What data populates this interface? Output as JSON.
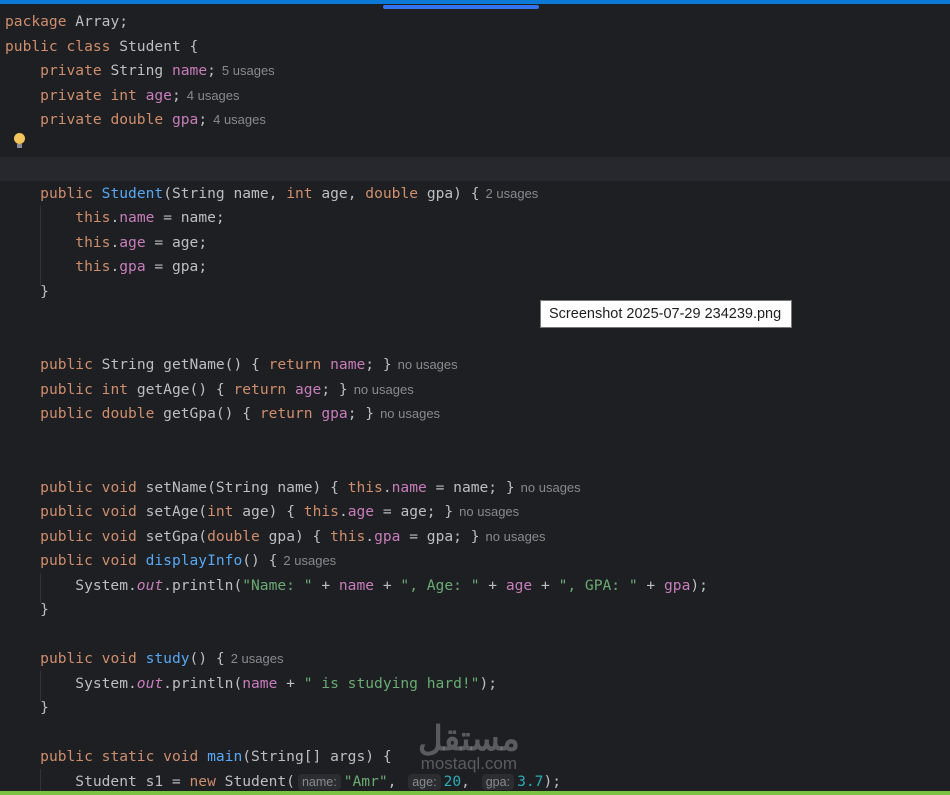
{
  "tooltip": "Screenshot 2025-07-29 234239.png",
  "watermark": {
    "arabic": "مستقل",
    "latin": "mostaql.com"
  },
  "colors": {
    "background": "#1e1f22",
    "keyword": "#cf8e6d",
    "field": "#c77dbb",
    "method": "#56a8f5",
    "string": "#6aab73",
    "number": "#2aacb8",
    "text": "#bcbec4",
    "hint": "#868a91"
  },
  "lines": [
    [
      [
        "k",
        "package "
      ],
      [
        "t",
        "Array;"
      ]
    ],
    [
      [
        "k",
        "public class "
      ],
      [
        "t",
        "Student {"
      ]
    ],
    [
      [
        "t",
        "    "
      ],
      [
        "k",
        "private "
      ],
      [
        "t",
        "String "
      ],
      [
        "f",
        "name"
      ],
      [
        "t",
        ";"
      ],
      [
        "u",
        "5 usages"
      ]
    ],
    [
      [
        "t",
        "    "
      ],
      [
        "k",
        "private int "
      ],
      [
        "f",
        "age"
      ],
      [
        "t",
        ";"
      ],
      [
        "u",
        "4 usages"
      ]
    ],
    [
      [
        "t",
        "    "
      ],
      [
        "k",
        "private double "
      ],
      [
        "f",
        "gpa"
      ],
      [
        "t",
        ";"
      ],
      [
        "u",
        "4 usages"
      ]
    ],
    [],
    [],
    [
      [
        "t",
        "    "
      ],
      [
        "k",
        "public "
      ],
      [
        "m",
        "Student"
      ],
      [
        "t",
        "(String name, "
      ],
      [
        "k",
        "int "
      ],
      [
        "t",
        "age, "
      ],
      [
        "k",
        "double "
      ],
      [
        "t",
        "gpa) {"
      ],
      [
        "u",
        "2 usages"
      ]
    ],
    [
      [
        "t",
        "        "
      ],
      [
        "k",
        "this"
      ],
      [
        "t",
        "."
      ],
      [
        "f",
        "name"
      ],
      [
        "t",
        " = name;"
      ]
    ],
    [
      [
        "t",
        "        "
      ],
      [
        "k",
        "this"
      ],
      [
        "t",
        "."
      ],
      [
        "f",
        "age"
      ],
      [
        "t",
        " = age;"
      ]
    ],
    [
      [
        "t",
        "        "
      ],
      [
        "k",
        "this"
      ],
      [
        "t",
        "."
      ],
      [
        "f",
        "gpa"
      ],
      [
        "t",
        " = gpa;"
      ]
    ],
    [
      [
        "t",
        "    }"
      ]
    ],
    [],
    [],
    [
      [
        "t",
        "    "
      ],
      [
        "k",
        "public "
      ],
      [
        "t",
        "String getName() { "
      ],
      [
        "k",
        "return "
      ],
      [
        "f",
        "name"
      ],
      [
        "t",
        "; }"
      ],
      [
        "u",
        "no usages"
      ]
    ],
    [
      [
        "t",
        "    "
      ],
      [
        "k",
        "public int "
      ],
      [
        "t",
        "getAge() { "
      ],
      [
        "k",
        "return "
      ],
      [
        "f",
        "age"
      ],
      [
        "t",
        "; }"
      ],
      [
        "u",
        "no usages"
      ]
    ],
    [
      [
        "t",
        "    "
      ],
      [
        "k",
        "public double "
      ],
      [
        "t",
        "getGpa() { "
      ],
      [
        "k",
        "return "
      ],
      [
        "f",
        "gpa"
      ],
      [
        "t",
        "; }"
      ],
      [
        "u",
        "no usages"
      ]
    ],
    [],
    [],
    [
      [
        "t",
        "    "
      ],
      [
        "k",
        "public void "
      ],
      [
        "t",
        "setName(String name) { "
      ],
      [
        "k",
        "this"
      ],
      [
        "t",
        "."
      ],
      [
        "f",
        "name"
      ],
      [
        "t",
        " = name; }"
      ],
      [
        "u",
        "no usages"
      ]
    ],
    [
      [
        "t",
        "    "
      ],
      [
        "k",
        "public void "
      ],
      [
        "t",
        "setAge("
      ],
      [
        "k",
        "int "
      ],
      [
        "t",
        "age) { "
      ],
      [
        "k",
        "this"
      ],
      [
        "t",
        "."
      ],
      [
        "f",
        "age"
      ],
      [
        "t",
        " = age; }"
      ],
      [
        "u",
        "no usages"
      ]
    ],
    [
      [
        "t",
        "    "
      ],
      [
        "k",
        "public void "
      ],
      [
        "t",
        "setGpa("
      ],
      [
        "k",
        "double "
      ],
      [
        "t",
        "gpa) { "
      ],
      [
        "k",
        "this"
      ],
      [
        "t",
        "."
      ],
      [
        "f",
        "gpa"
      ],
      [
        "t",
        " = gpa; }"
      ],
      [
        "u",
        "no usages"
      ]
    ],
    [
      [
        "t",
        "    "
      ],
      [
        "k",
        "public void "
      ],
      [
        "m",
        "displayInfo"
      ],
      [
        "t",
        "() {"
      ],
      [
        "u",
        "2 usages"
      ]
    ],
    [
      [
        "t",
        "        System."
      ],
      [
        "o",
        "out"
      ],
      [
        "t",
        ".println("
      ],
      [
        "s",
        "\"Name: \""
      ],
      [
        "t",
        " + "
      ],
      [
        "f",
        "name"
      ],
      [
        "t",
        " + "
      ],
      [
        "s",
        "\", Age: \""
      ],
      [
        "t",
        " + "
      ],
      [
        "f",
        "age"
      ],
      [
        "t",
        " + "
      ],
      [
        "s",
        "\", GPA: \""
      ],
      [
        "t",
        " + "
      ],
      [
        "f",
        "gpa"
      ],
      [
        "t",
        ");"
      ]
    ],
    [
      [
        "t",
        "    }"
      ]
    ],
    [],
    [
      [
        "t",
        "    "
      ],
      [
        "k",
        "public void "
      ],
      [
        "m",
        "study"
      ],
      [
        "t",
        "() {"
      ],
      [
        "u",
        "2 usages"
      ]
    ],
    [
      [
        "t",
        "        System."
      ],
      [
        "o",
        "out"
      ],
      [
        "t",
        ".println("
      ],
      [
        "f",
        "name"
      ],
      [
        "t",
        " + "
      ],
      [
        "s",
        "\" is studying hard!\""
      ],
      [
        "t",
        ");"
      ]
    ],
    [
      [
        "t",
        "    }"
      ]
    ],
    [],
    [
      [
        "t",
        "    "
      ],
      [
        "k",
        "public static void "
      ],
      [
        "m",
        "main"
      ],
      [
        "t",
        "(String[] args) {"
      ]
    ],
    [
      [
        "t",
        "        Student s1 = "
      ],
      [
        "k",
        "new "
      ],
      [
        "t",
        "Student("
      ],
      [
        "h",
        "name:"
      ],
      [
        "s",
        "\"Amr\""
      ],
      [
        "t",
        ", "
      ],
      [
        "h",
        "age:"
      ],
      [
        "n",
        "20"
      ],
      [
        "t",
        ", "
      ],
      [
        "h",
        "gpa:"
      ],
      [
        "n",
        "3.7"
      ],
      [
        "t",
        ");"
      ]
    ]
  ]
}
